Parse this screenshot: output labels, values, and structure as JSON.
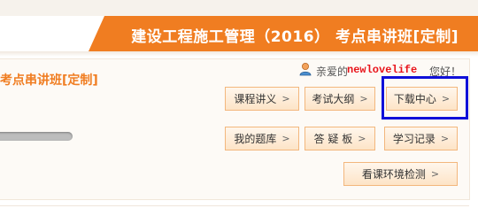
{
  "header": {
    "title": "建设工程施工管理（2016） 考点串讲班[定制]"
  },
  "panel": {
    "title": "考点串讲班[定制]",
    "welcome": {
      "greeting": "亲爱的",
      "username": "newlovelife",
      "suffix": "您好！"
    }
  },
  "buttons": [
    {
      "id": "course-notes",
      "label": "课程讲义"
    },
    {
      "id": "exam-outline",
      "label": "考试大纲"
    },
    {
      "id": "download-center",
      "label": "下载中心"
    },
    {
      "id": "question-bank",
      "label": "我的题库"
    },
    {
      "id": "qa-board",
      "label": "答 疑 板"
    },
    {
      "id": "study-record",
      "label": "学习记录"
    },
    {
      "id": "env-check",
      "label": "看课环境检测"
    }
  ],
  "colors": {
    "accent": "#f07d21",
    "highlight": "#1010d9",
    "username": "#e8131a"
  }
}
